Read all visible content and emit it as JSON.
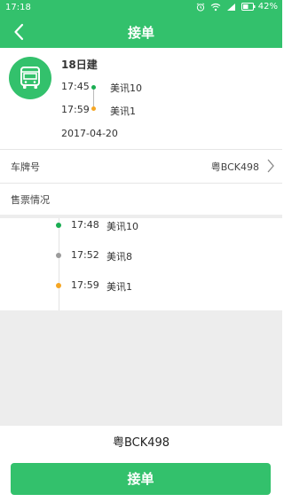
{
  "status_bar": {
    "time": "17:18",
    "battery": "42%"
  },
  "header": {
    "title": "接单"
  },
  "trip": {
    "route": "18日建",
    "stops": [
      {
        "time": "17:45",
        "name": "美讯10",
        "dot_color": "#1aad52"
      },
      {
        "time": "17:59",
        "name": "美讯1",
        "dot_color": "#f5a623"
      }
    ],
    "date": "2017-04-20"
  },
  "plate_row": {
    "label": "车牌号",
    "value": "粤BCK498"
  },
  "ticket_row": {
    "label": "售票情况"
  },
  "timeline": [
    {
      "time": "17:48",
      "name": "美讯10",
      "dot_color": "#1aad52"
    },
    {
      "time": "17:52",
      "name": "美讯8",
      "dot_color": "#9b9b9b"
    },
    {
      "time": "17:59",
      "name": "美讯1",
      "dot_color": "#f5a623"
    }
  ],
  "bottom_plate": "粤BCK498",
  "accept_button": "接单",
  "colors": {
    "primary": "#33c16c"
  }
}
